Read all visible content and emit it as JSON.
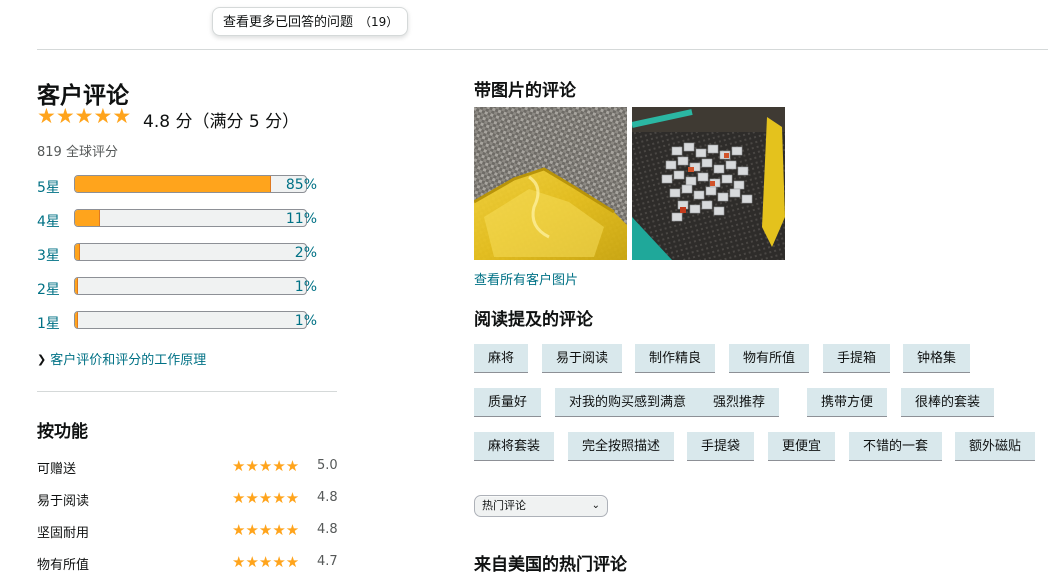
{
  "top": {
    "see_more_label": "查看更多已回答的问题",
    "see_more_count": "（19）"
  },
  "ratings": {
    "title": "客户评论",
    "average_text": "4.8 分（满分 5 分）",
    "average_value": 4.8,
    "total_text": "819 全球评分",
    "histogram": [
      {
        "label": "5星",
        "percent_text": "85%",
        "percent": 85
      },
      {
        "label": "4星",
        "percent_text": "11%",
        "percent": 11
      },
      {
        "label": "3星",
        "percent_text": "2%",
        "percent": 2
      },
      {
        "label": "2星",
        "percent_text": "1%",
        "percent": 1
      },
      {
        "label": "1星",
        "percent_text": "1%",
        "percent": 1
      }
    ],
    "how_link": "客户评价和评分的工作原理"
  },
  "features": {
    "title": "按功能",
    "items": [
      {
        "name": "可赠送",
        "value": "5.0"
      },
      {
        "name": "易于阅读",
        "value": "4.8"
      },
      {
        "name": "坚固耐用",
        "value": "4.8"
      },
      {
        "name": "物有所值",
        "value": "4.7"
      }
    ]
  },
  "images_section": {
    "title": "带图片的评论",
    "see_all_link": "查看所有客户图片",
    "photos": [
      "yellow-mahjong-case-photo",
      "mahjong-tiles-pile-photo"
    ]
  },
  "mentions": {
    "title": "阅读提及的评论",
    "chips": [
      "麻将",
      "易于阅读",
      "制作精良",
      "物有所值",
      "手提箱",
      "钟格集",
      "质量好",
      "对我的购买感到满意",
      "强烈推荐",
      "携带方便",
      "很棒的套装",
      "麻将套装",
      "完全按照描述",
      "手提袋",
      "更便宜",
      "不错的一套",
      "额外磁贴"
    ]
  },
  "sort": {
    "selected": "热门评论"
  },
  "us_reviews": {
    "title": "来自美国的热门评论"
  },
  "colors": {
    "star": "#ffa41c",
    "link": "#007185",
    "chip_bg": "#d9e8ec"
  }
}
